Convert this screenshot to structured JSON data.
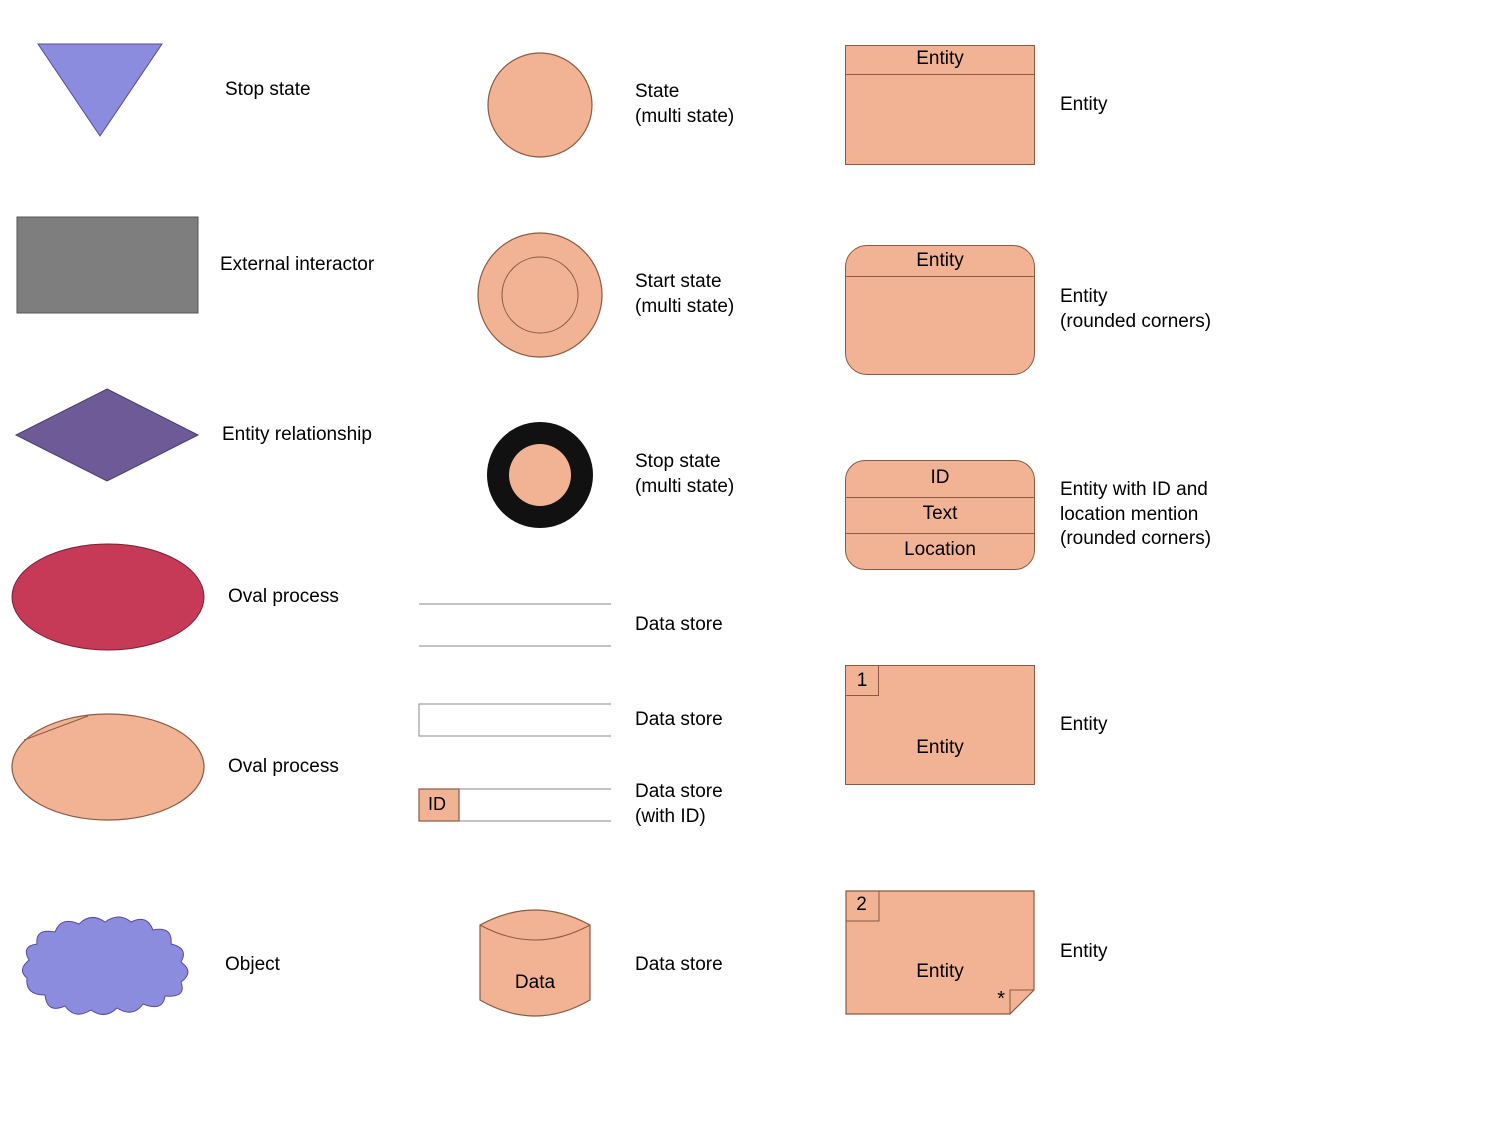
{
  "col1": {
    "stop_state": "Stop state",
    "external_interactor": "External interactor",
    "entity_relationship": "Entity relationship",
    "oval_process_1": "Oval process",
    "oval_process_2": "Oval process",
    "object": "Object"
  },
  "col2": {
    "state_multi": "State\n(multi state)",
    "start_state_multi": "Start state\n(multi state)",
    "stop_state_multi": "Stop state\n(multi state)",
    "data_store_1": "Data store",
    "data_store_2": "Data store",
    "data_store_id_label": "Data store\n(with ID)",
    "data_store_id_badge": "ID",
    "data_store_cyl": "Data store",
    "cylinder_text": "Data"
  },
  "col3": {
    "entity1_header": "Entity",
    "entity1_label": "Entity",
    "entity2_header": "Entity",
    "entity2_label": "Entity\n(rounded corners)",
    "entity3_rows": {
      "id": "ID",
      "text": "Text",
      "location": "Location"
    },
    "entity3_label": "Entity with ID and\nlocation mention\n(rounded corners)",
    "entity4_num": "1",
    "entity4_body": "Entity",
    "entity4_label": "Entity",
    "entity5_num": "2",
    "entity5_body": "Entity",
    "entity5_star": "*",
    "entity5_label": "Entity"
  }
}
